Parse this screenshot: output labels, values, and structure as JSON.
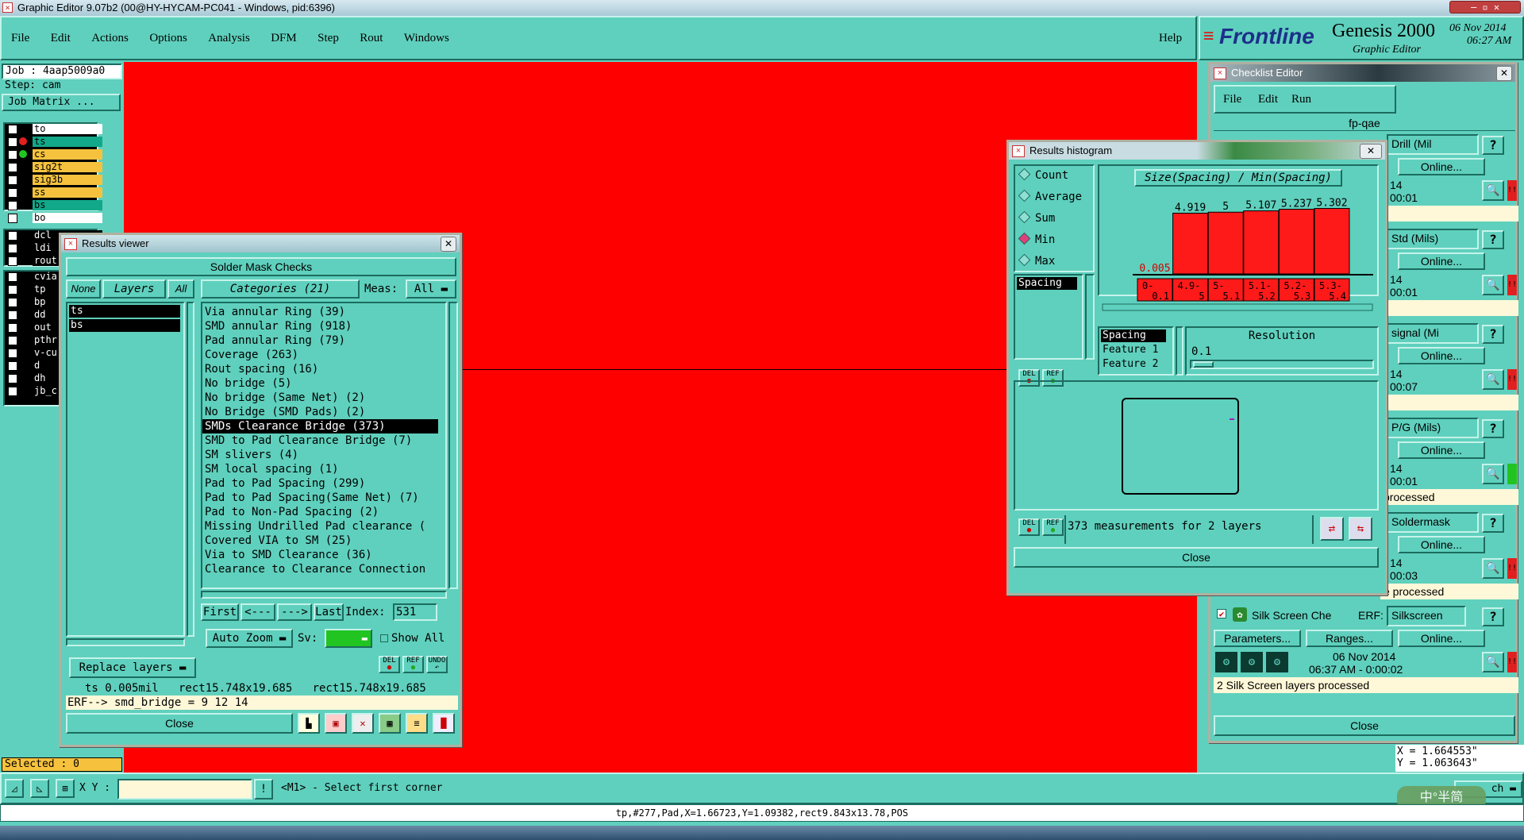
{
  "window": {
    "title": "Graphic Editor 9.07b2 (00@HY-HYCAM-PC041 - Windows, pid:6396)"
  },
  "menubar": {
    "items": [
      "File",
      "Edit",
      "Actions",
      "Options",
      "Analysis",
      "DFM",
      "Step",
      "Rout",
      "Windows"
    ],
    "help": "Help"
  },
  "brand": {
    "logo": "Frontline",
    "product": "Genesis 2000",
    "subtitle": "Graphic Editor",
    "date": "06 Nov 2014",
    "time": "06:27 AM"
  },
  "job": {
    "job_label": "Job : 4aap5009a0",
    "step_label": "Step: cam",
    "matrix_button": "Job Matrix ..."
  },
  "layers": {
    "group1": [
      {
        "name": "to",
        "color": "#ffffff"
      },
      {
        "name": "ts",
        "color": "#12a88a"
      },
      {
        "name": "cs",
        "color": "#f6c23e"
      },
      {
        "name": "sig2t",
        "color": "#f6c23e"
      },
      {
        "name": "sig3b",
        "color": "#f6c23e"
      },
      {
        "name": "ss",
        "color": "#f6c23e"
      },
      {
        "name": "bs",
        "color": "#12a88a"
      },
      {
        "name": "bo",
        "color": "#ffffff"
      }
    ],
    "group2": [
      "dcl",
      "ldi",
      "rout"
    ],
    "group3": [
      "cvia",
      "tp",
      "bp",
      "dd",
      "out",
      "pthr",
      "v-cu",
      "d",
      "dh",
      "jb_c"
    ]
  },
  "selected": "Selected : 0",
  "results_viewer": {
    "title": "Results viewer",
    "header": "Solder Mask Checks",
    "none_btn": "None",
    "layers_label": "Layers",
    "all_btn": "All",
    "categories_label": "Categories (21)",
    "meas_label": "Meas:",
    "meas_value": "All",
    "layer_list": [
      "ts",
      "bs"
    ],
    "categories": [
      "Via annular Ring (39)",
      "SMD annular Ring (918)",
      "Pad annular Ring (79)",
      "Coverage (263)",
      "Rout spacing (16)",
      "No bridge (5)",
      "No bridge (Same Net) (2)",
      "No Bridge (SMD Pads) (2)",
      "SMDs Clearance Bridge (373)",
      "SMD to Pad Clearance Bridge (7)",
      "SM slivers (4)",
      "SM local spacing (1)",
      "Pad to Pad Spacing (299)",
      "Pad to Pad Spacing(Same Net) (7)",
      "Pad to Non-Pad Spacing (2)",
      "Missing Undrilled Pad clearance (",
      "Covered VIA to SM (25)",
      "Via to SMD Clearance (36)",
      "Clearance to Clearance Connection"
    ],
    "selected_category": 8,
    "nav": {
      "first": "First",
      "prev": "<---",
      "next": "--->",
      "last": "Last",
      "index_label": "Index:",
      "index_value": "531"
    },
    "auto_zoom": "Auto Zoom",
    "sv_label": "Sv:",
    "show_all": "Show All",
    "replace_layers": "Replace layers",
    "info_line": "ts 0.005mil   rect15.748x19.685   rect15.748x19.685",
    "erf_line": "ERF--> smd_bridge = 9 12 14",
    "close": "Close",
    "del": "DEL",
    "ref": "REF",
    "undo": "UNDO"
  },
  "histogram": {
    "title": "Results histogram",
    "modes": [
      "Count",
      "Average",
      "Sum",
      "Min",
      "Max"
    ],
    "selected_mode": "Min",
    "chart_title": "Size(Spacing) / Min(Spacing)",
    "attr_list": [
      "Spacing"
    ],
    "value_labels": [
      "0.005",
      "4.919",
      "5",
      "5.107",
      "5.237",
      "5.302"
    ],
    "bins": [
      "0-\n0.1",
      "4.9-\n5",
      "5-\n5.1",
      "5.1-\n5.2",
      "5.2-\n5.3",
      "5.3-\n5.4"
    ],
    "feature_list": [
      "Spacing",
      "Feature 1",
      "Feature 2"
    ],
    "resolution_label": "Resolution",
    "resolution_value": "0.1",
    "measurements": "373 measurements for 2 layers",
    "close": "Close",
    "del": "DEL",
    "ref": "REF"
  },
  "chart_data": {
    "type": "bar",
    "title": "Size(Spacing) / Min(Spacing)",
    "categories": [
      "0-0.1",
      "4.9-5",
      "5-5.1",
      "5.1-5.2",
      "5.2-5.3",
      "5.3-5.4"
    ],
    "values": [
      0.005,
      4.919,
      5,
      5.107,
      5.237,
      5.302
    ],
    "ylim": [
      0,
      5.4
    ]
  },
  "checklist": {
    "title": "Checklist Editor",
    "menu": [
      "File",
      "Edit",
      "Run"
    ],
    "name": "fp-qae",
    "rows": [
      {
        "label": "Drill (Mil",
        "online": "Online...",
        "time1": "14",
        "time2": "00:01",
        "flag": "!!",
        "flagcolor": "#e02020",
        "status": ""
      },
      {
        "label": "Std (Mils)",
        "online": "Online...",
        "time1": "14",
        "time2": "00:01",
        "flag": "!!",
        "flagcolor": "#e02020",
        "status": ""
      },
      {
        "label": "signal (Mi",
        "online": "Online...",
        "time1": "14",
        "time2": "00:07",
        "flag": "!!",
        "flagcolor": "#e02020",
        "status": ""
      },
      {
        "label": "P/G (Mils)",
        "online": "Online...",
        "time1": "14",
        "time2": "00:01",
        "flag": "",
        "flagcolor": "#21c421",
        "status": "processed"
      },
      {
        "label": "Soldermask",
        "online": "Online...",
        "time1": "14",
        "time2": "00:03",
        "flag": "!!",
        "flagcolor": "#e02020",
        "status": "e processed"
      }
    ],
    "silk": {
      "name": "Silk Screen Che",
      "erf": "ERF:",
      "erf_value": "Silkscreen",
      "params": "Parameters...",
      "ranges": "Ranges...",
      "online": "Online...",
      "date": "06 Nov 2014",
      "time": "06:37 AM - 0:00:02",
      "status": "2 Silk Screen layers processed"
    },
    "close": "Close"
  },
  "coords": {
    "x": "X = 1.664553\"",
    "y": "Y = 1.063643\""
  },
  "bottom": {
    "xy_label": "X Y :",
    "prompt": "<M1> - Select first corner",
    "status": "tp,#277,Pad,X=1.66723,Y=1.09382,rect9.843x13.78,POS",
    "watermark": "中°半简",
    "search_partial": "ch"
  }
}
